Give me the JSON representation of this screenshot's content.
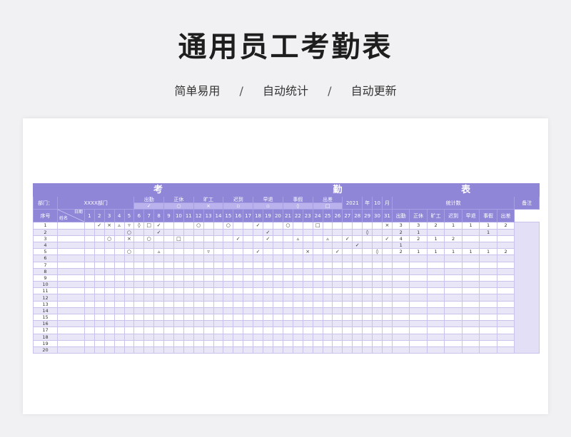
{
  "header": {
    "title": "通用员工考勤表",
    "subtitle_items": [
      "简单易用",
      "自动统计",
      "自动更新"
    ],
    "separator": "/"
  },
  "sheet": {
    "title_chars": [
      "考",
      "勤",
      "表"
    ],
    "dept_label": "部门：",
    "dept_value": "XXXX部门",
    "legend": [
      {
        "label": "出勤",
        "symbol": "✓"
      },
      {
        "label": "正休",
        "symbol": "○"
      },
      {
        "label": "旷工",
        "symbol": "×"
      },
      {
        "label": "迟到",
        "symbol": "▫"
      },
      {
        "label": "早退",
        "symbol": "▫"
      },
      {
        "label": "事假",
        "symbol": "◊"
      },
      {
        "label": "出差",
        "symbol": "□"
      }
    ],
    "year": "2021",
    "year_label": "年",
    "month": "10",
    "month_label": "月",
    "stats_label": "统计数",
    "notes_label": "备注",
    "seq_label": "序号",
    "date_label": "日期",
    "name_label": "姓名",
    "days": [
      "1",
      "2",
      "3",
      "4",
      "5",
      "6",
      "7",
      "8",
      "9",
      "10",
      "11",
      "12",
      "13",
      "14",
      "15",
      "16",
      "17",
      "18",
      "19",
      "20",
      "21",
      "22",
      "23",
      "24",
      "25",
      "26",
      "27",
      "28",
      "29",
      "30",
      "31"
    ],
    "stat_cols": [
      "出勤",
      "正休",
      "旷工",
      "迟到",
      "早退",
      "事假",
      "出差"
    ],
    "rows": [
      {
        "seq": "1",
        "marks": {
          "3": "✓",
          "4": "×",
          "5": "▵",
          "6": "▿",
          "7": "◊",
          "8": "□",
          "9": "✓",
          "13": "○",
          "16": "○",
          "19": "✓",
          "22": "○",
          "25": "□",
          "32": "×"
        },
        "stats": [
          "3",
          "3",
          "2",
          "1",
          "1",
          "1",
          "2"
        ]
      },
      {
        "seq": "2",
        "marks": {
          "6": "○",
          "9": "✓",
          "20": "✓",
          "30": "◊"
        },
        "stats": [
          "2",
          "1",
          "",
          "",
          "",
          "1",
          ""
        ]
      },
      {
        "seq": "3",
        "marks": {
          "4": "○",
          "6": "×",
          "8": "○",
          "11": "□",
          "17": "✓",
          "20": "✓",
          "23": "▵",
          "26": "▵",
          "28": "✓",
          "32": "✓"
        },
        "stats": [
          "4",
          "2",
          "1",
          "2",
          "",
          "",
          ""
        ]
      },
      {
        "seq": "4",
        "marks": {
          "29": "✓"
        },
        "stats": [
          "1",
          "",
          "",
          "",
          "",
          "",
          ""
        ]
      },
      {
        "seq": "5",
        "marks": {
          "6": "○",
          "9": "▵",
          "14": "▿",
          "19": "✓",
          "24": "×",
          "27": "✓",
          "31": "◊"
        },
        "stats": [
          "2",
          "1",
          "1",
          "1",
          "1",
          "1",
          "2"
        ]
      },
      {
        "seq": "6",
        "marks": {},
        "stats": [
          "",
          "",
          "",
          "",
          "",
          "",
          ""
        ]
      },
      {
        "seq": "7",
        "marks": {},
        "stats": [
          "",
          "",
          "",
          "",
          "",
          "",
          ""
        ]
      },
      {
        "seq": "8",
        "marks": {},
        "stats": [
          "",
          "",
          "",
          "",
          "",
          "",
          ""
        ]
      },
      {
        "seq": "9",
        "marks": {},
        "stats": [
          "",
          "",
          "",
          "",
          "",
          "",
          ""
        ]
      },
      {
        "seq": "10",
        "marks": {},
        "stats": [
          "",
          "",
          "",
          "",
          "",
          "",
          ""
        ]
      },
      {
        "seq": "11",
        "marks": {},
        "stats": [
          "",
          "",
          "",
          "",
          "",
          "",
          ""
        ]
      },
      {
        "seq": "12",
        "marks": {},
        "stats": [
          "",
          "",
          "",
          "",
          "",
          "",
          ""
        ]
      },
      {
        "seq": "13",
        "marks": {},
        "stats": [
          "",
          "",
          "",
          "",
          "",
          "",
          ""
        ]
      },
      {
        "seq": "14",
        "marks": {},
        "stats": [
          "",
          "",
          "",
          "",
          "",
          "",
          ""
        ]
      },
      {
        "seq": "15",
        "marks": {},
        "stats": [
          "",
          "",
          "",
          "",
          "",
          "",
          ""
        ]
      },
      {
        "seq": "16",
        "marks": {},
        "stats": [
          "",
          "",
          "",
          "",
          "",
          "",
          ""
        ]
      },
      {
        "seq": "17",
        "marks": {},
        "stats": [
          "",
          "",
          "",
          "",
          "",
          "",
          ""
        ]
      },
      {
        "seq": "18",
        "marks": {},
        "stats": [
          "",
          "",
          "",
          "",
          "",
          "",
          ""
        ]
      },
      {
        "seq": "19",
        "marks": {},
        "stats": [
          "",
          "",
          "",
          "",
          "",
          "",
          ""
        ]
      },
      {
        "seq": "20",
        "marks": {},
        "stats": [
          "",
          "",
          "",
          "",
          "",
          "",
          ""
        ]
      }
    ]
  },
  "colors": {
    "header_purple": "#8f86d8",
    "stripe": "#e9e6f8",
    "notes_bg": "#e3dff7"
  }
}
